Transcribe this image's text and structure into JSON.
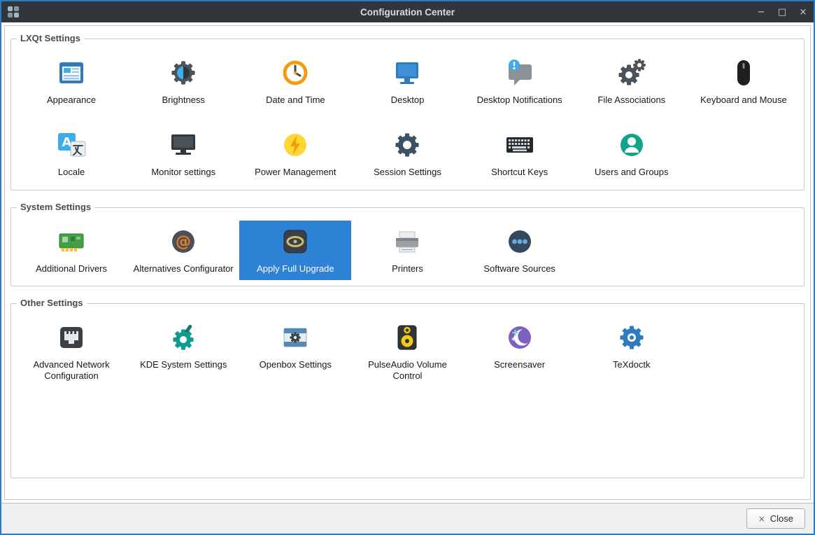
{
  "window": {
    "title": "Configuration Center",
    "controls": {
      "minimize": "−",
      "maximize": "□",
      "close": "×"
    }
  },
  "colors": {
    "window_border": "#2d7ac8",
    "titlebar_bg": "#31363b",
    "highlight": "#2e82d6"
  },
  "sections": [
    {
      "title": "LXQt Settings",
      "items": [
        {
          "label": "Appearance",
          "icon": "appearance-icon"
        },
        {
          "label": "Brightness",
          "icon": "brightness-icon"
        },
        {
          "label": "Date and Time",
          "icon": "date-time-icon"
        },
        {
          "label": "Desktop",
          "icon": "desktop-icon"
        },
        {
          "label": "Desktop Notifications",
          "icon": "desktop-notifications-icon"
        },
        {
          "label": "File Associations",
          "icon": "file-associations-icon"
        },
        {
          "label": "Keyboard and Mouse",
          "icon": "keyboard-mouse-icon"
        },
        {
          "label": "Locale",
          "icon": "locale-icon"
        },
        {
          "label": "Monitor settings",
          "icon": "monitor-settings-icon"
        },
        {
          "label": "Power Management",
          "icon": "power-management-icon"
        },
        {
          "label": "Session Settings",
          "icon": "session-settings-icon"
        },
        {
          "label": "Shortcut Keys",
          "icon": "shortcut-keys-icon"
        },
        {
          "label": "Users and Groups",
          "icon": "users-groups-icon"
        }
      ]
    },
    {
      "title": "System Settings",
      "items": [
        {
          "label": "Additional Drivers",
          "icon": "additional-drivers-icon"
        },
        {
          "label": "Alternatives Configurator",
          "icon": "alternatives-configurator-icon"
        },
        {
          "label": "Apply Full Upgrade",
          "icon": "apply-full-upgrade-icon",
          "selected": true
        },
        {
          "label": "Printers",
          "icon": "printers-icon"
        },
        {
          "label": "Software Sources",
          "icon": "software-sources-icon"
        }
      ]
    },
    {
      "title": "Other Settings",
      "items": [
        {
          "label": "Advanced Network Configuration",
          "icon": "advanced-network-configuration-icon"
        },
        {
          "label": "KDE System Settings",
          "icon": "kde-system-settings-icon"
        },
        {
          "label": "Openbox Settings",
          "icon": "openbox-settings-icon"
        },
        {
          "label": "PulseAudio Volume Control",
          "icon": "pulseaudio-volume-control-icon"
        },
        {
          "label": "Screensaver",
          "icon": "screensaver-icon"
        },
        {
          "label": "TeXdoctk",
          "icon": "texdoctk-icon"
        }
      ]
    }
  ],
  "footer": {
    "close_label": "Close",
    "close_icon": "×"
  }
}
